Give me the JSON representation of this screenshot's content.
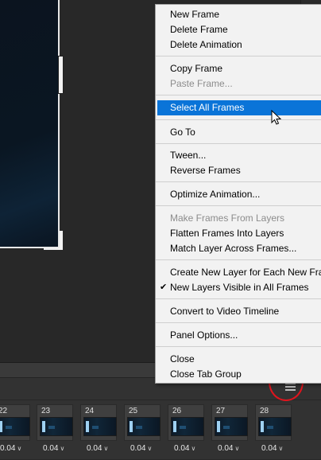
{
  "menu": {
    "items": [
      {
        "label": "New Frame",
        "enabled": true
      },
      {
        "label": "Delete Frame",
        "enabled": true
      },
      {
        "label": "Delete Animation",
        "enabled": true
      },
      {
        "label": "Copy Frame",
        "enabled": true
      },
      {
        "label": "Paste Frame...",
        "enabled": false
      },
      {
        "label": "Select All Frames",
        "enabled": true,
        "highlighted": true
      },
      {
        "label": "Go To",
        "enabled": true
      },
      {
        "label": "Tween...",
        "enabled": true
      },
      {
        "label": "Reverse Frames",
        "enabled": true
      },
      {
        "label": "Optimize Animation...",
        "enabled": true
      },
      {
        "label": "Make Frames From Layers",
        "enabled": false
      },
      {
        "label": "Flatten Frames Into Layers",
        "enabled": true
      },
      {
        "label": "Match Layer Across Frames...",
        "enabled": true
      },
      {
        "label": "Create New Layer for Each New Frame",
        "enabled": true
      },
      {
        "label": "New Layers Visible in All Frames",
        "enabled": true,
        "checked": true
      },
      {
        "label": "Convert to Video Timeline",
        "enabled": true
      },
      {
        "label": "Panel Options...",
        "enabled": true
      },
      {
        "label": "Close",
        "enabled": true
      },
      {
        "label": "Close Tab Group",
        "enabled": true
      }
    ]
  },
  "timeline": {
    "frames": [
      {
        "number": "22",
        "delay": "0.04"
      },
      {
        "number": "23",
        "delay": "0.04"
      },
      {
        "number": "24",
        "delay": "0.04"
      },
      {
        "number": "25",
        "delay": "0.04"
      },
      {
        "number": "26",
        "delay": "0.04"
      },
      {
        "number": "27",
        "delay": "0.04"
      },
      {
        "number": "28",
        "delay": "0.04"
      }
    ]
  },
  "icons": {
    "panel_menu": "hamburger-menu-icon",
    "checkmark": "checkmark-icon",
    "caret": "caret-down-icon",
    "cursor": "mouse-pointer-icon"
  },
  "colors": {
    "highlight": "#0a74d8",
    "annotation_circle": "#e0141d",
    "menu_background": "#f2f2f2",
    "panel_background": "#282828"
  }
}
